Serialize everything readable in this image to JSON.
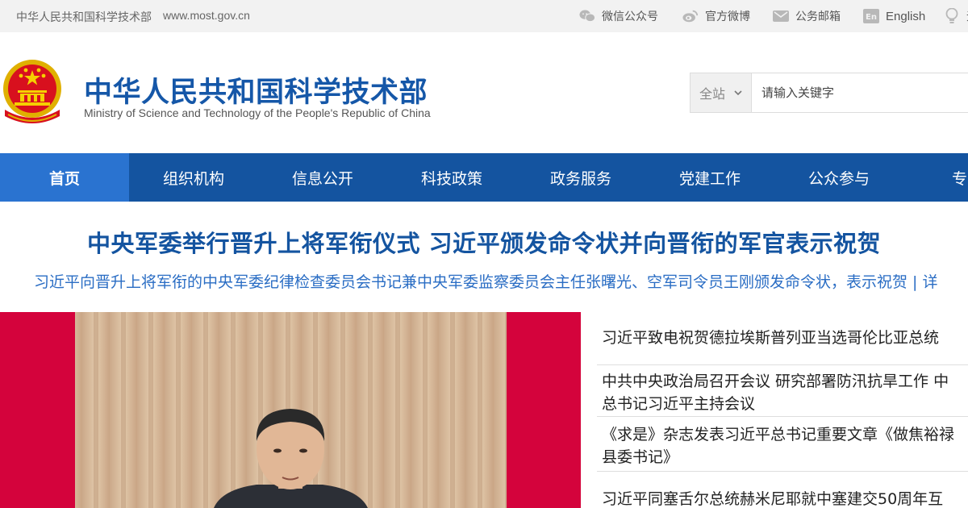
{
  "topbar": {
    "site_name": "中华人民共和国科学技术部",
    "site_url": "www.most.gov.cn",
    "links": {
      "wechat": "微信公众号",
      "weibo": "官方微博",
      "mail": "公务邮箱",
      "english": "English",
      "aged": "无"
    }
  },
  "header": {
    "title_cn": "中华人民共和国科学技术部",
    "title_en": "Ministry of Science and Technology of the People's Republic of China"
  },
  "search": {
    "scope": "全站",
    "placeholder": "请输入关键字"
  },
  "nav": {
    "items": [
      "首页",
      "组织机构",
      "信息公开",
      "科技政策",
      "政务服务",
      "党建工作",
      "公众参与",
      "专"
    ]
  },
  "headline": {
    "title": "中央军委举行晋升上将军衔仪式 习近平颁发命令状并向晋衔的军官表示祝贺",
    "subtitle": "习近平向晋升上将军衔的中央军委纪律检查委员会书记兼中央军委监察委员会主任张曙光、空军司令员王刚颁发命令状，表示祝贺 | 详"
  },
  "news": {
    "items": [
      {
        "line1": "习近平致电祝贺德拉埃斯普列亚当选哥伦比亚总统",
        "line2": ""
      },
      {
        "line1": "中共中央政治局召开会议 研究部署防汛抗旱工作 中",
        "line2": "总书记习近平主持会议"
      },
      {
        "line1": "《求是》杂志发表习近平总书记重要文章《做焦裕禄",
        "line2": "县委书记》"
      },
      {
        "line1": "习近平同塞舌尔总统赫米尼耶就中塞建交50周年互",
        "line2": ""
      }
    ]
  },
  "colors": {
    "brand_blue": "#1557a8",
    "nav_bg": "#1454a0",
    "nav_active": "#2a73d0",
    "photo_red": "#d4033c"
  }
}
